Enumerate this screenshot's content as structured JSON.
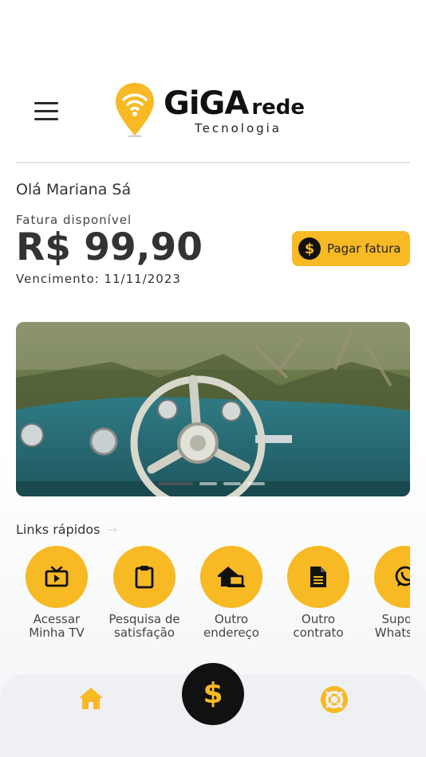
{
  "header": {
    "brand_main": "GiGA",
    "brand_rede": "rede",
    "brand_sub": "Tecnologia"
  },
  "account": {
    "greeting": "Olá Mariana Sá",
    "invoice_label": "Fatura disponível",
    "amount": "R$ 99,90",
    "due": "Vencimento: 11/11/2023",
    "pay_button": "Pagar fatura",
    "pay_icon_glyph": "$"
  },
  "banner": {
    "slides_total": 4,
    "active_slide": 1
  },
  "quick_links": {
    "title": "Links rápidos",
    "arrow": "→",
    "items": [
      {
        "label": "Acessar\nMinha TV",
        "icon": "tv-icon"
      },
      {
        "label": "Pesquisa de\nsatisfação",
        "icon": "clipboard-icon"
      },
      {
        "label": "Outro\nendereço",
        "icon": "house-laptop-icon"
      },
      {
        "label": "Outro\ncontrato",
        "icon": "document-icon"
      },
      {
        "label": "Suporte\nWhatsApp",
        "icon": "whatsapp-icon"
      }
    ]
  },
  "bottom_nav": {
    "pay_glyph": "$",
    "items": [
      "home-icon",
      "dollar-icon",
      "support-lifebuoy-icon"
    ]
  },
  "colors": {
    "accent": "#f7b924",
    "dark": "#111111",
    "nav_bg": "#eef0f4"
  }
}
